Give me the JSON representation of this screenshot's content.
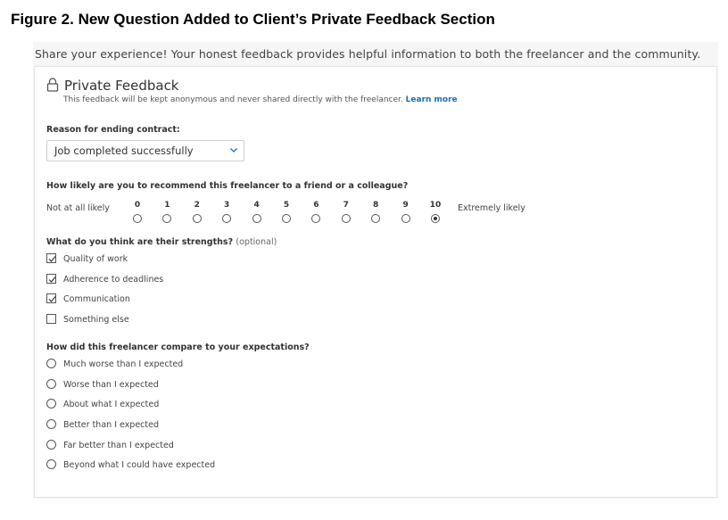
{
  "caption": "Figure 2.  New Question Added to Client’s Private Feedback Section",
  "intro": "Share your experience! Your honest feedback provides helpful information to both the freelancer and the community.",
  "private_feedback": {
    "title": "Private Feedback",
    "subtitle": "This feedback will be kept anonymous and never shared directly with the freelancer.",
    "learn_more": "Learn more"
  },
  "reason": {
    "label": "Reason for ending contract:",
    "selected": "Job completed successfully"
  },
  "recommend": {
    "question": "How likely are you to recommend this freelancer to a friend or a colleague?",
    "low_label": "Not at all likely",
    "high_label": "Extremely likely",
    "scale": [
      "0",
      "1",
      "2",
      "3",
      "4",
      "5",
      "6",
      "7",
      "8",
      "9",
      "10"
    ],
    "selected": "10"
  },
  "strengths": {
    "question": "What do you think are their strengths?",
    "optional": "(optional)",
    "options": [
      {
        "label": "Quality of work",
        "checked": true
      },
      {
        "label": "Adherence to deadlines",
        "checked": true
      },
      {
        "label": "Communication",
        "checked": true
      },
      {
        "label": "Something else",
        "checked": false
      }
    ]
  },
  "expectations": {
    "question": "How did this freelancer compare to your expectations?",
    "options": [
      "Much worse than I expected",
      "Worse than I expected",
      "About what I expected",
      "Better than I expected",
      "Far better than I expected",
      "Beyond what I could have expected"
    ]
  }
}
